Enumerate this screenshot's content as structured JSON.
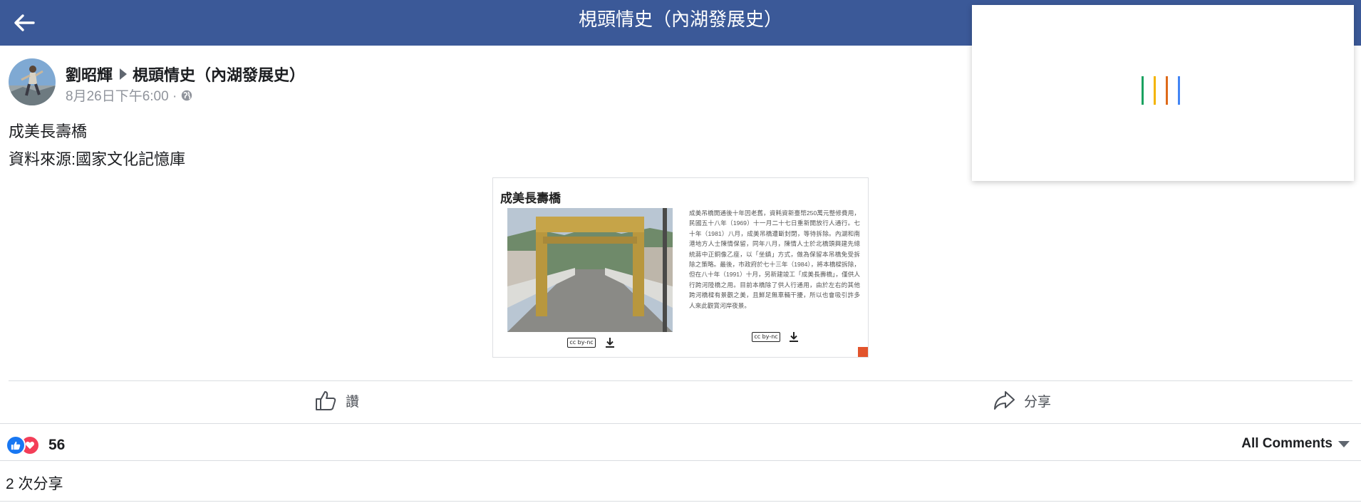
{
  "header": {
    "title": "梘頭情史（內湖發展史）"
  },
  "post": {
    "author": "劉昭輝",
    "group": "梘頭情史（內湖發展史）",
    "timestamp": "8月26日下午6:00 ·",
    "privacy_icon": "globe-icon",
    "text_lines": [
      "成美長壽橋",
      "資料來源:國家文化記憶庫"
    ]
  },
  "attachment": {
    "title": "成美長壽橋",
    "description": "成美吊橋開通後十年因老舊，資耗資新臺幣250萬元整修費用，民國五十八年（1969）十一月二十七日重新開放行人通行。七十年（1981）八月，成美吊橋遭斷封閉，等待拆除。內湖和南港地方人士陳情保留，同年八月，陳情人士於北橋頭興建先總統蔣中正銅像乙座，以「坐鎮」方式，做為保留本吊橋免受拆除之策略。最後，市政府於七十三年（1984），將本橋樑拆除，但在八十年（1991）十月，另新建竣工「成美長壽橋」，僅供人行跨河陸橋之用。目前本橋除了供人行通用，由於左右的其他跨河橋樑有景觀之美，且鮮足無車輛干擾，所以也會吸引許多人來此觀賞河岸夜景。",
    "license_label": "cc by-nc",
    "download_icon": "download-icon"
  },
  "actions": {
    "like_label": "讚",
    "share_label": "分享"
  },
  "stats": {
    "reaction_count": "56",
    "comments_filter": "All Comments",
    "share_count_text": "2 次分享"
  },
  "colors": {
    "header_bg": "#3b5998",
    "like_blue": "#1877f2",
    "love_red": "#f33e58",
    "spinner": [
      "#1aa260",
      "#f4b400",
      "#de6a1a",
      "#4285f4"
    ]
  }
}
